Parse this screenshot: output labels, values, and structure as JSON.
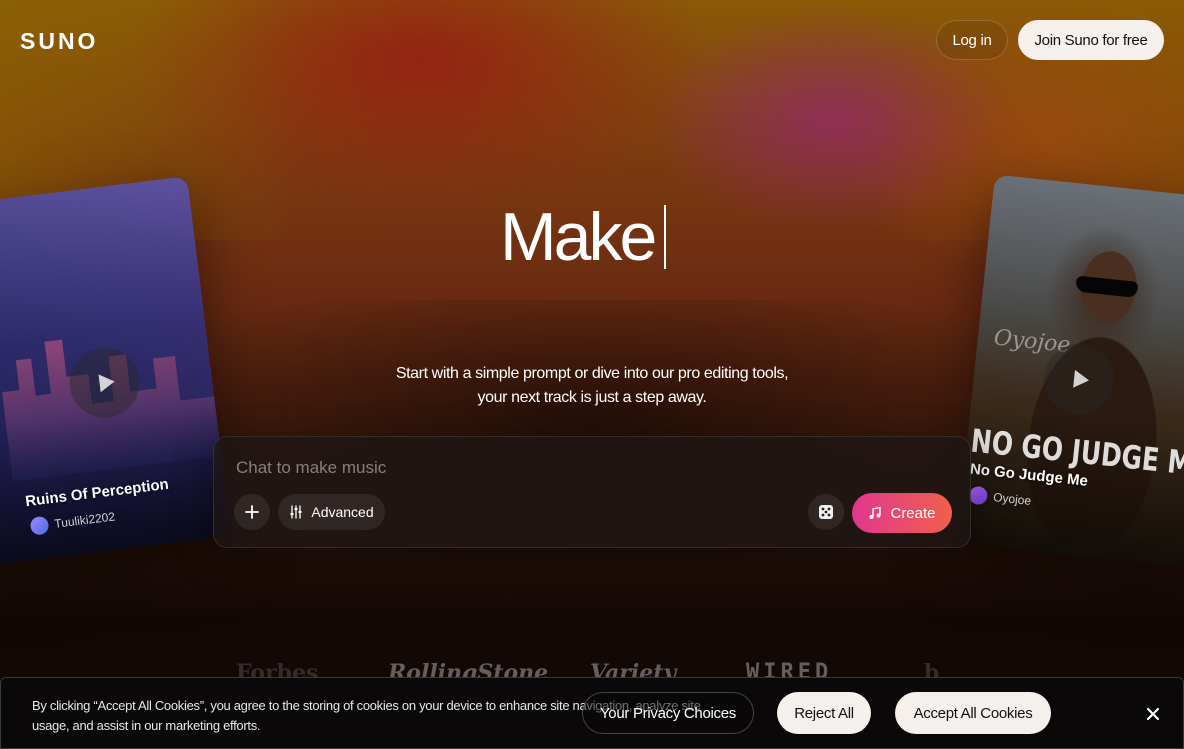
{
  "header": {
    "logo": "SUNO",
    "login_label": "Log in",
    "join_label": "Join Suno for free"
  },
  "hero": {
    "title": "Make",
    "subtitle": "Start with a simple prompt or dive into our pro editing tools, your next track is just a step away."
  },
  "prompt": {
    "placeholder": "Chat to make music",
    "advanced_label": "Advanced",
    "create_label": "Create"
  },
  "cards": [
    {
      "title": "Ruins Of Perception",
      "user": "Tuuliki2202"
    },
    {
      "title": "No Go Judge Me",
      "user": "Oyojoe",
      "art_text": "NO GO JUDGE ME",
      "art_script": "Oyojoe"
    }
  ],
  "press": [
    "Forbes",
    "RollingStone",
    "Variety",
    "WIRED",
    "b"
  ],
  "cookie": {
    "text": "By clicking “Accept All Cookies”, you agree to the storing of cookies on your device to enhance site navigation, analyze site usage, and assist in our marketing efforts.",
    "privacy_label": "Your Privacy Choices",
    "reject_label": "Reject All",
    "accept_label": "Accept All Cookies"
  },
  "colors": {
    "create_gradient_start": "#e0378f",
    "create_gradient_end": "#f0604a",
    "button_light": "#f5f0ec"
  },
  "icons": {
    "plus": "plus-icon",
    "advanced": "sliders-icon",
    "dice": "dice-icon",
    "create": "music-note-icon",
    "close": "close-icon",
    "play": "play-icon"
  }
}
